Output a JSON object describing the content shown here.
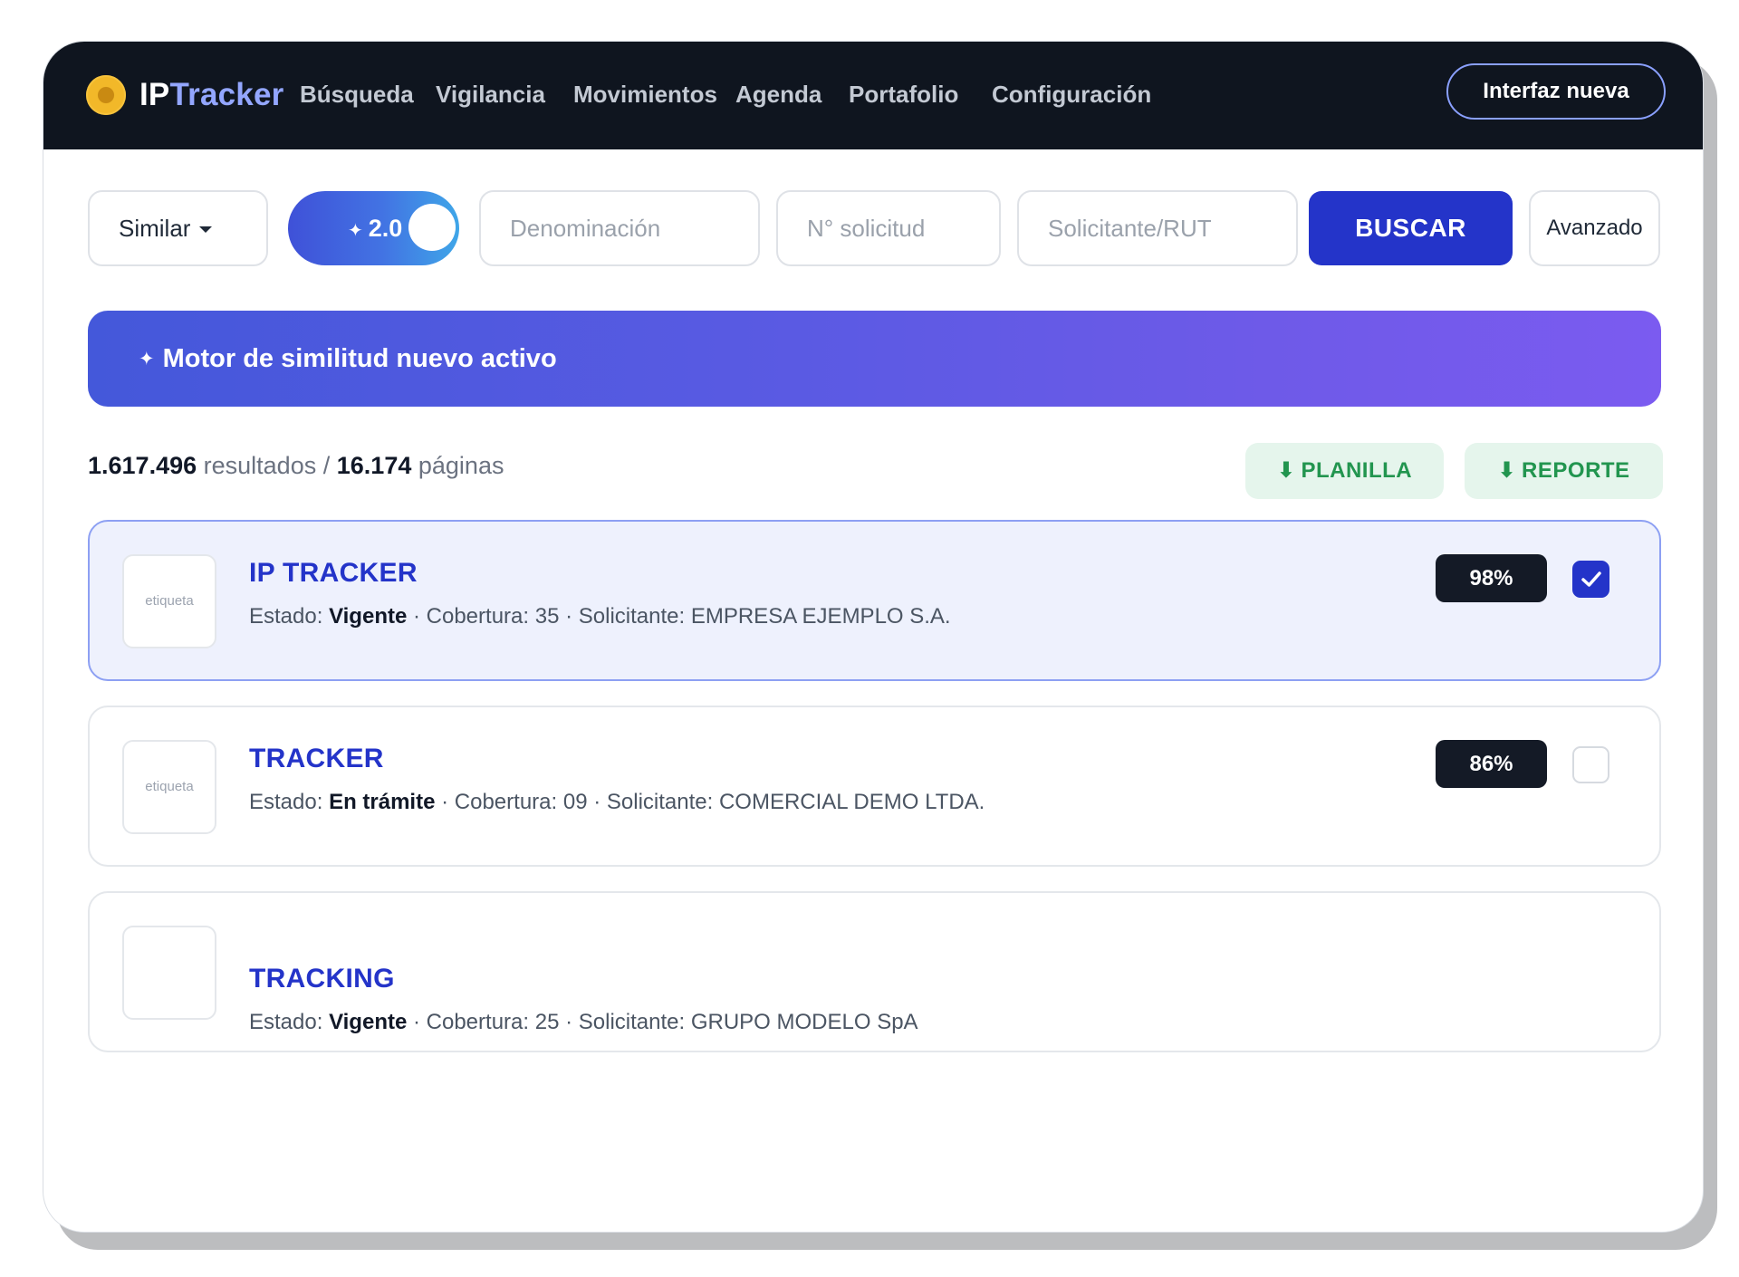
{
  "header": {
    "logo_prefix": "IP",
    "logo_suffix": "Tracker",
    "nav": [
      {
        "label": "Búsqueda"
      },
      {
        "label": "Vigilancia"
      },
      {
        "label": "Movimientos"
      },
      {
        "label": "Agenda"
      },
      {
        "label": "Portafolio"
      },
      {
        "label": "Configuración"
      }
    ],
    "new_ui_label": "Interfaz nueva"
  },
  "search": {
    "mode_selected": "Similar",
    "engine_toggle_label": "2.0",
    "engine_toggle_on": true,
    "denomination_placeholder": "Denominación",
    "denomination_value": "",
    "application_placeholder": "N° solicitud",
    "application_value": "",
    "applicant_placeholder": "Solicitante/RUT",
    "applicant_value": "",
    "search_label": "BUSCAR",
    "advanced_label": "Avanzado"
  },
  "banner": {
    "text": "Motor de similitud nuevo activo"
  },
  "summary": {
    "results_count": "1.617.496",
    "results_word": "resultados",
    "separator": "/",
    "pages_count": "16.174",
    "pages_word": "páginas"
  },
  "downloads": {
    "sheet_label": "PLANILLA",
    "report_label": "REPORTE"
  },
  "labels": {
    "estado": "Estado:",
    "cobertura": "Cobertura:",
    "solicitante": "Solicitante:"
  },
  "results": [
    {
      "thumb_text": "etiqueta",
      "title": "IP TRACKER",
      "estado": "Vigente",
      "cobertura": "35",
      "solicitante": "EMPRESA EJEMPLO S.A.",
      "score": "98%",
      "checked": true
    },
    {
      "thumb_text": "etiqueta",
      "title": "TRACKER",
      "estado": "En trámite",
      "cobertura": "09",
      "solicitante": "COMERCIAL DEMO LTDA.",
      "score": "86%",
      "checked": false
    },
    {
      "thumb_text": "",
      "title": "TRACKING",
      "estado": "Vigente",
      "cobertura": "25",
      "solicitante": "GRUPO MODELO SpA"
    }
  ],
  "colors": {
    "header_bg": "#0f151f",
    "accent": "#2434c9",
    "logo_accent": "#93a6ff",
    "download_green": "#22954f"
  }
}
